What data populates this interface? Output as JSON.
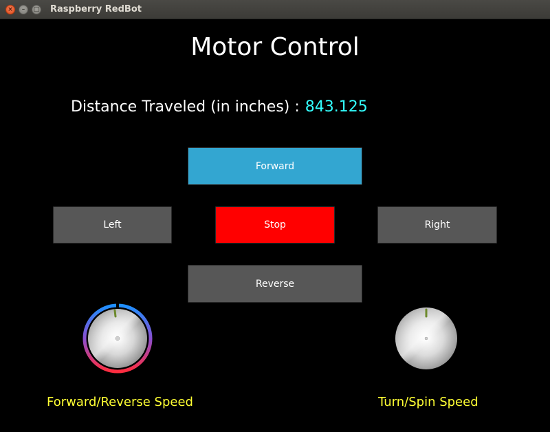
{
  "window": {
    "title": "Raspberry RedBot",
    "controls": {
      "close": "×",
      "minimize": "–",
      "maximize": "□"
    }
  },
  "main": {
    "heading": "Motor Control",
    "distance_label": "Distance Traveled (in inches) :",
    "distance_value": "843.125"
  },
  "buttons": {
    "forward": "Forward",
    "left": "Left",
    "stop": "Stop",
    "right": "Right",
    "reverse": "Reverse"
  },
  "dials": {
    "forward_reverse": {
      "label": "Forward/Reverse Speed",
      "level": 0.5
    },
    "turn_spin": {
      "label": "Turn/Spin Speed",
      "level": 0.5
    }
  },
  "colors": {
    "forward_button": "#33a6d1",
    "stop_button": "#ff0000",
    "neutral_button": "#575757",
    "distance_value": "#33ffff",
    "dial_label": "#ffff33",
    "ring_start": "#1e90ff",
    "ring_end": "#ff2d3f"
  }
}
